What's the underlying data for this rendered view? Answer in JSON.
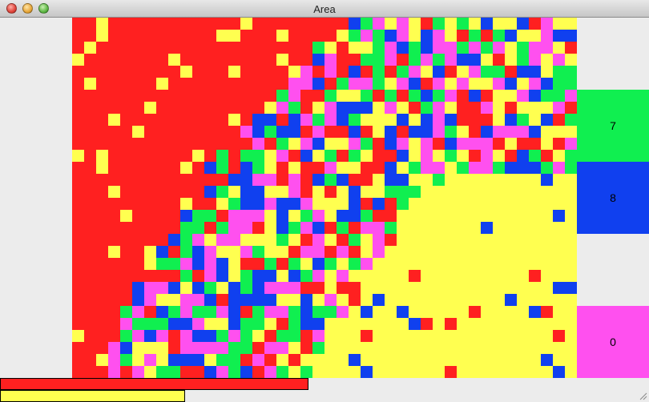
{
  "window": {
    "title": "Area"
  },
  "colors": {
    "red": "#ff2020",
    "yellow": "#ffff50",
    "green": "#10ef50",
    "blue": "#1040ef",
    "magenta": "#ff50ef"
  },
  "board": {
    "cols": 42,
    "rows": 30,
    "palette": [
      "red",
      "yellow",
      "green",
      "blue",
      "magenta"
    ]
  },
  "scores": [
    {
      "value": "7",
      "color": "green"
    },
    {
      "value": "8",
      "color": "blue"
    },
    {
      "value": "0",
      "color": "magenta"
    }
  ],
  "progress": [
    {
      "color": "red",
      "fraction": 0.475
    },
    {
      "color": "yellow",
      "fraction": 0.285
    }
  ]
}
